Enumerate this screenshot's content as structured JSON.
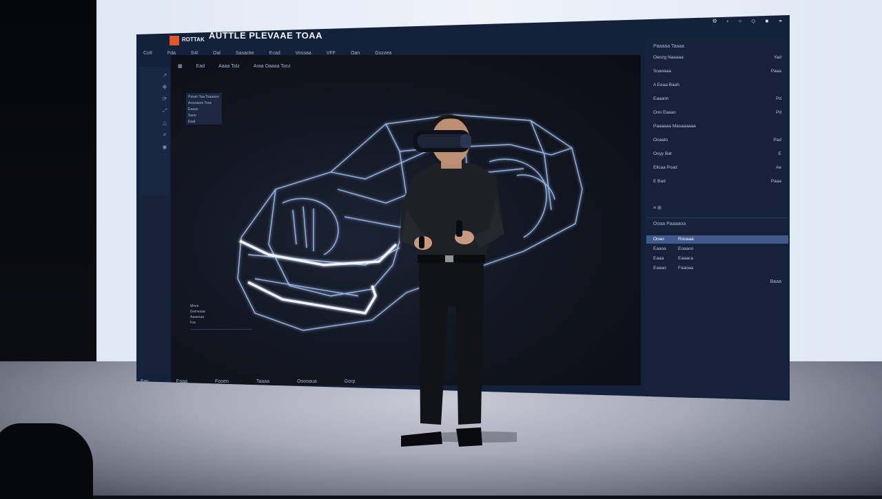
{
  "app": {
    "logo_text": "",
    "app_name": "ROTTAK",
    "title": "AUTTLE PLEVAAE TOAA"
  },
  "menu": [
    "Co8",
    "Fda",
    "S4l",
    "Oal",
    "Sasacke",
    "Ecad",
    "Vossaa",
    "VFF",
    "Oan",
    "Gozzea"
  ],
  "viewport_toolbar": [
    "Ead",
    "Aaaa Tolz",
    "Araa Oaaaa Tocz"
  ],
  "layers": [
    "Pasan Yaa Taaaaon",
    "Aoszaaoo Tose",
    "Eaaoo",
    "Saoo",
    "Eaat"
  ],
  "info_lines": [
    "Mmm",
    "Gamesaa",
    "Aaaenaa",
    "Fac"
  ],
  "status": [
    "Fas",
    "Eoaa",
    "Fooeo",
    "Taaaa",
    "Ooooaua",
    "Gorp"
  ],
  "right_panel": {
    "header": "Paaaaa Taaaa",
    "props": [
      {
        "label": "Oaozg Naaaaa",
        "value": "Yad"
      },
      {
        "label": "Soaoaaa",
        "value": "Paaa"
      },
      {
        "label": "A Eeaa Baah",
        "value": ""
      },
      {
        "label": "Eaaaon",
        "value": "Pd"
      },
      {
        "label": "Ooo Eaaao",
        "value": "Pd"
      },
      {
        "label": "Paaaaaa Masaaaaaa",
        "value": ""
      },
      {
        "label": "Ooaato",
        "value": "Pad"
      },
      {
        "label": "Ooyy Bat",
        "value": "E"
      },
      {
        "label": "Ellcaa Poad",
        "value": "Ae"
      },
      {
        "label": "E Bad",
        "value": "Paaa"
      }
    ],
    "section": "Ooaa Paaaaoa",
    "list": [
      {
        "label": "Ooao",
        "value": "Rooaaa"
      },
      {
        "label": "Eaaoa",
        "value": "Eoaaoo"
      },
      {
        "label": "Eaaa",
        "value": "Eaaaca"
      },
      {
        "label": "Eaaao",
        "value": "Faaoaa"
      }
    ],
    "footer": "Baaa"
  },
  "colors": {
    "screen_bg": "#14213a",
    "accent": "#e0572a",
    "wireframe": "#a9c8ff",
    "selection": "#3f5a8c"
  }
}
